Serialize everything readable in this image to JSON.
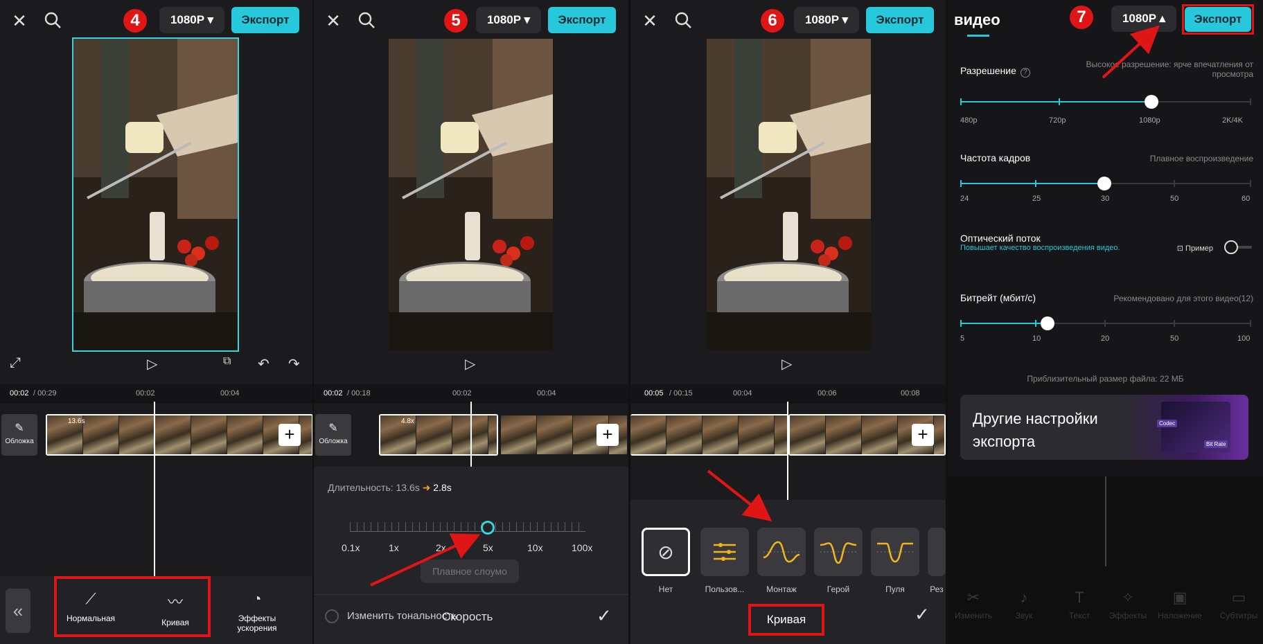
{
  "panels": [
    {
      "step": "4",
      "resolution": "1080P ▾",
      "export": "Экспорт",
      "time_current": "00:02",
      "time_total": "/ 00:29",
      "ruler_marks": [
        "00:02",
        "00:04"
      ],
      "cover": "Обложка",
      "clip_duration": "13.6s",
      "tools": [
        {
          "label": "Нормальная"
        },
        {
          "label": "Кривая"
        },
        {
          "label": "Эффекты ускорения"
        }
      ]
    },
    {
      "step": "5",
      "resolution": "1080P ▾",
      "export": "Экспорт",
      "time_current": "00:02",
      "time_total": "/ 00:18",
      "ruler_marks": [
        "00:02",
        "00:04"
      ],
      "cover": "Обложка",
      "clip_duration": "4.8x",
      "duration_label": "Длительность:",
      "duration_from": "13.6s",
      "duration_to": "2.8s",
      "speed_marks": [
        "0.1x",
        "1x",
        "2x",
        "5x",
        "10x",
        "100x"
      ],
      "speed_value": 5,
      "smooth": "Плавное слоумо",
      "tone": "Изменить тональность",
      "title_overlap": "Скорость"
    },
    {
      "step": "6",
      "resolution": "1080P ▾",
      "export": "Экспорт",
      "time_current": "00:05",
      "time_total": "/ 00:15",
      "ruler_marks": [
        "00:04",
        "00:06",
        "00:08"
      ],
      "curves": [
        {
          "label": "Нет"
        },
        {
          "label": "Пользов..."
        },
        {
          "label": "Монтаж"
        },
        {
          "label": "Герой"
        },
        {
          "label": "Пуля"
        },
        {
          "label": "Рез"
        }
      ],
      "title": "Кривая"
    },
    {
      "step": "7",
      "tab": "видео",
      "resolution": "1080P ▴",
      "export": "Экспорт",
      "resolution_label": "Разрешение",
      "resolution_hint": "Высокое разрешение: ярче впечатления от просмотра",
      "resolution_marks": [
        "480p",
        "720p",
        "1080p",
        "2K/4K"
      ],
      "resolution_value": "1080p",
      "fps_label": "Частота кадров",
      "fps_hint": "Плавное воспроизведение",
      "fps_marks": [
        "24",
        "25",
        "30",
        "50",
        "60"
      ],
      "fps_value": 30,
      "flow_label": "Оптический поток",
      "flow_hint": "Повышает качество воспроизведения видео.",
      "flow_example": "Пример",
      "flow_on": false,
      "bitrate_label": "Битрейт (мбит/с)",
      "bitrate_hint": "Рекомендовано для этого видео(12)",
      "bitrate_marks": [
        "5",
        "10",
        "20",
        "50",
        "100"
      ],
      "bitrate_value": 12,
      "file_size": "Приблизительный размер файла: 22 МБ",
      "promo": "Другие настройки экспорта",
      "promo_badge1": "Codec",
      "promo_badge2": "Bit Rate",
      "ghost_tools": [
        "Изменить",
        "Звук",
        "Текст",
        "Эффекты",
        "Наложение",
        "Субтитры"
      ]
    }
  ],
  "colors": {
    "accent": "#27c7dc",
    "highlight": "#e01515",
    "curve": "#f3b51f"
  }
}
